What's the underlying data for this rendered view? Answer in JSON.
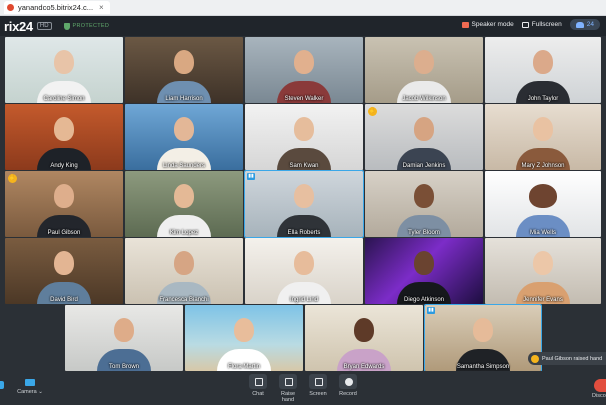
{
  "browser": {
    "tab_title": "yanandco5.bitrix24.c..."
  },
  "header": {
    "logo": "rix24",
    "hd_badge": "HD",
    "protected_label": "PROTECTED",
    "speaker_mode": "Speaker mode",
    "fullscreen": "Fullscreen",
    "participant_count": "24"
  },
  "participants": [
    {
      "name": "Caroline Simon"
    },
    {
      "name": "Liam Harrison"
    },
    {
      "name": "Steven Walker"
    },
    {
      "name": "Jacob Wilkinson"
    },
    {
      "name": "John Taylor"
    },
    {
      "name": "Andy King"
    },
    {
      "name": "Linda Saunders"
    },
    {
      "name": "Sam Kwan"
    },
    {
      "name": "Damian Jenkins"
    },
    {
      "name": "Mary Z Johnson"
    },
    {
      "name": "Paul Gibson"
    },
    {
      "name": "Kim Lopez"
    },
    {
      "name": "Ella Roberts"
    },
    {
      "name": "Tyler Bloom"
    },
    {
      "name": "Mia Wells"
    },
    {
      "name": "David Bird"
    },
    {
      "name": "Francesca Bianchi"
    },
    {
      "name": "Ingrid Lind"
    },
    {
      "name": "Diego Atkinson"
    },
    {
      "name": "Jennifer Evans"
    },
    {
      "name": "Tom Brown"
    },
    {
      "name": "Flora Martin"
    },
    {
      "name": "Bryan Edwards"
    },
    {
      "name": "Samantha Simpson"
    }
  ],
  "toast": {
    "text": "Paul Gibson raised hand"
  },
  "toolbar": {
    "camera": "Camera",
    "chat": "Chat",
    "raise_hand": "Raise hand",
    "screen": "Screen",
    "record": "Record",
    "disconnect": "Disco"
  },
  "colors": {
    "accent": "#3aa7e8",
    "raise_hand": "#f5b41d",
    "disconnect": "#e24e3e",
    "protected": "#5fa86b"
  }
}
